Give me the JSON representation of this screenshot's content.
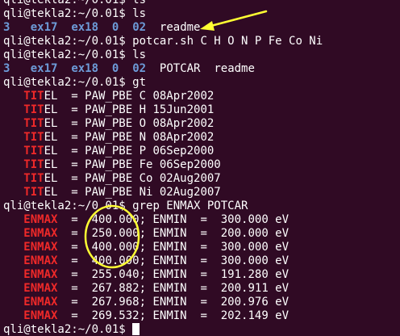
{
  "terminal": {
    "colors": {
      "background": "#300a24",
      "text": "#ffffff",
      "directory": "#6d9bd8",
      "grep_match": "#ef2929",
      "annotation": "#ffff33"
    },
    "partial_top_line": "qli@tekla2:~/0.01$ ls",
    "prompt": "qli@tekla2:~/0.01$",
    "cmd_ls_1": "ls",
    "ls_1": {
      "dirs": [
        "3",
        "ex17",
        "ex18",
        "0",
        "02"
      ],
      "files": [
        "readme"
      ]
    },
    "cmd_potcar": "potcar.sh C H O N P Fe Co Ni",
    "cmd_ls_2": "ls",
    "ls_2": {
      "dirs": [
        "3",
        "ex17",
        "ex18",
        "0",
        "02"
      ],
      "files": [
        "POTCAR",
        "readme"
      ]
    },
    "cmd_gt": "gt",
    "titel_match": "TIT",
    "titel_lines": [
      "EL  = PAW_PBE C 08Apr2002",
      "EL  = PAW_PBE H 15Jun2001",
      "EL  = PAW_PBE O 08Apr2002",
      "EL  = PAW_PBE N 08Apr2002",
      "EL  = PAW_PBE P 06Sep2000",
      "EL  = PAW_PBE Fe 06Sep2000",
      "EL  = PAW_PBE Co 02Aug2007",
      "EL  = PAW_PBE Ni 02Aug2007"
    ],
    "cmd_grep": "grep ENMAX POTCAR",
    "enmax_match": "ENMAX",
    "enmax_lines": [
      "  =  400.000; ENMIN  =  300.000 eV",
      "  =  250.000; ENMIN  =  200.000 eV",
      "  =  400.000; ENMIN  =  300.000 eV",
      "  =  400.000; ENMIN  =  300.000 eV",
      "  =  255.040; ENMIN  =  191.280 eV",
      "  =  267.882; ENMIN  =  200.911 eV",
      "  =  267.968; ENMIN  =  200.976 eV",
      "  =  269.532; ENMIN  =  202.149 eV"
    ]
  }
}
